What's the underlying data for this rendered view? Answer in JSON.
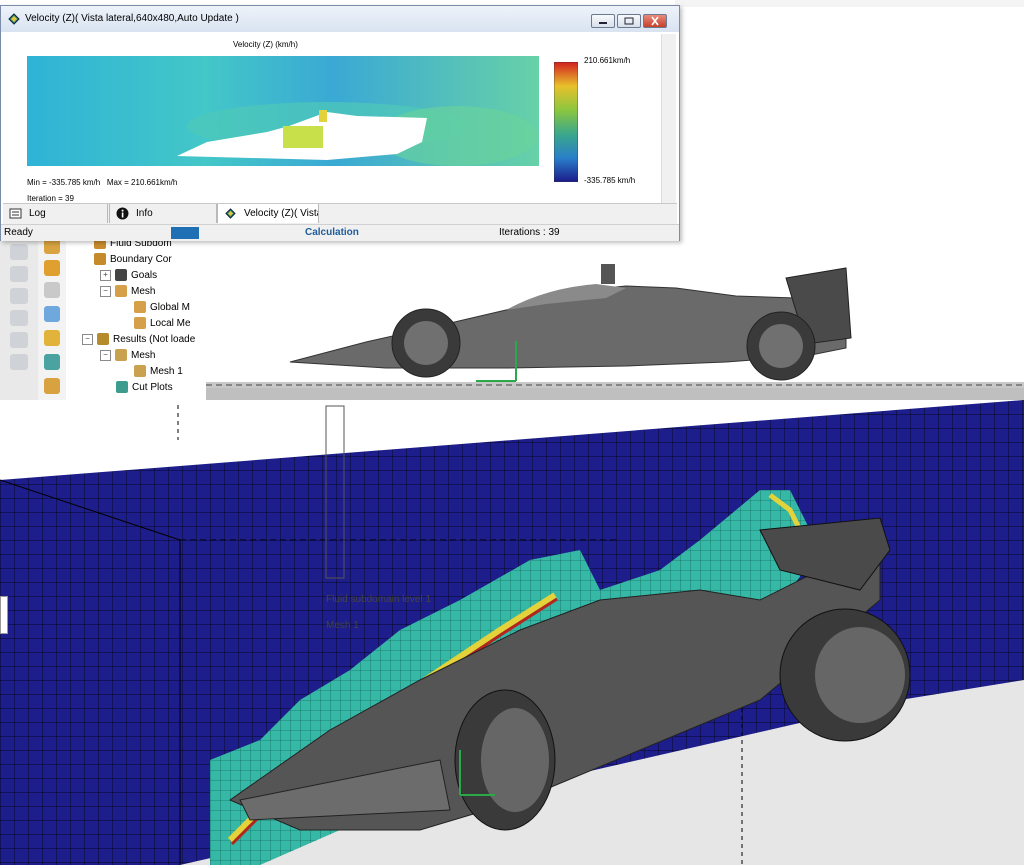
{
  "velocity_window": {
    "title": "Velocity (Z)( Vista lateral,640x480,Auto Update )",
    "plot_title": "Velocity (Z) (km/h)",
    "legend_max": "210.661km/h",
    "legend_min": "-335.785 km/h",
    "min_max_text": "Min = -335.785 km/h   Max = 210.661km/h",
    "iteration_text": "Iteration = 39",
    "tabs": [
      {
        "label": "Log",
        "icon": "log-icon"
      },
      {
        "label": "Info",
        "icon": "info-icon"
      },
      {
        "label": "Velocity (Z)( Vista lat",
        "icon": "velocity-plot-icon"
      }
    ],
    "status": {
      "left": "Ready",
      "center": "Calculation",
      "right": "Iterations : 39",
      "progress_fraction": 0.2
    }
  },
  "tree": {
    "items": [
      {
        "label": "Fluid Subdom",
        "icon": "fluid-subdomain-icon",
        "level": 1
      },
      {
        "label": "Boundary Cor",
        "icon": "boundary-condition-icon",
        "level": 1
      },
      {
        "label": "Goals",
        "icon": "goals-icon",
        "level": 1,
        "expander": "+"
      },
      {
        "label": "Mesh",
        "icon": "mesh-icon",
        "level": 1,
        "expander": "−"
      },
      {
        "label": "Global M",
        "icon": "global-mesh-icon",
        "level": 2
      },
      {
        "label": "Local Me",
        "icon": "local-mesh-icon",
        "level": 2
      },
      {
        "label": "Results (Not loade",
        "icon": "results-icon",
        "level": 0,
        "expander": "−"
      },
      {
        "label": "Mesh",
        "icon": "mesh-icon",
        "level": 1,
        "expander": "−"
      },
      {
        "label": "Mesh 1",
        "icon": "mesh-icon",
        "level": 2
      },
      {
        "label": "Cut Plots",
        "icon": "cut-plots-icon",
        "level": 1
      }
    ]
  },
  "view3d": {
    "overlay_label_1": "Fluid subdomain level 1",
    "overlay_label_2": "Mesh 1"
  },
  "colors": {
    "mesh_blue": "#1d1d8c",
    "mesh_cyan": "#35b8a6",
    "mesh_yellow": "#e3d23a",
    "mesh_red": "#b3261e",
    "car_gray": "#5a5a5a",
    "accent_blue": "#1f6fb5"
  }
}
